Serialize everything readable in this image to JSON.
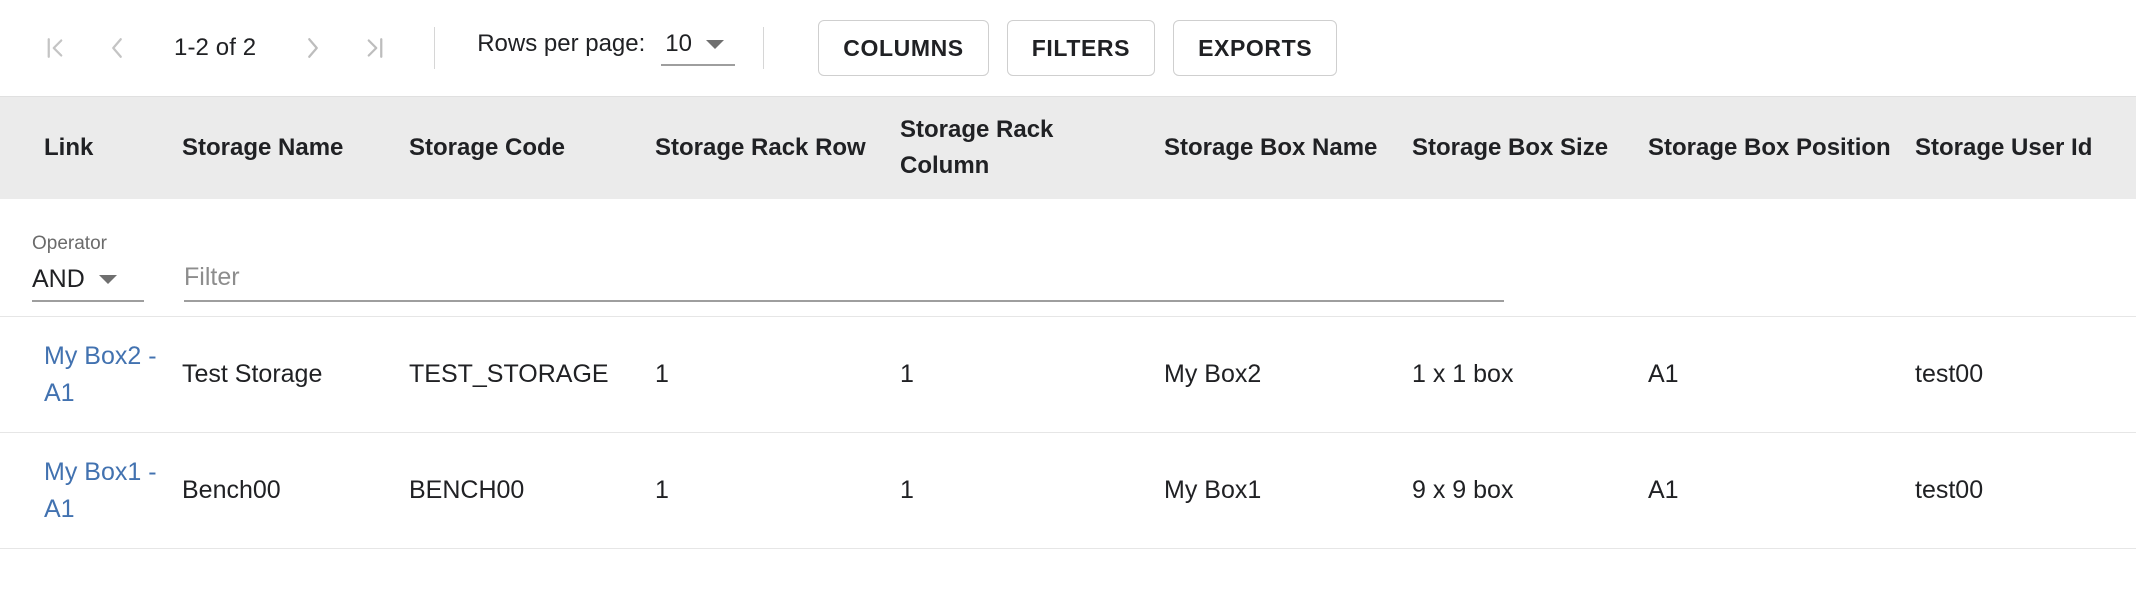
{
  "toolbar": {
    "first_page_icon": "first-page-icon",
    "prev_page_icon": "chevron-left-icon",
    "page_range": "1-2 of 2",
    "next_page_icon": "chevron-right-icon",
    "last_page_icon": "last-page-icon",
    "rows_per_page_label": "Rows per page:",
    "rows_per_page_value": "10",
    "dropdown_icon": "chevron-down-icon",
    "columns_label": "COLUMNS",
    "filters_label": "FILTERS",
    "exports_label": "EXPORTS"
  },
  "filter_bar": {
    "operator_label": "Operator",
    "operator_value": "AND",
    "operator_dropdown_icon": "chevron-down-icon",
    "filter_placeholder": "Filter",
    "filter_value": ""
  },
  "table": {
    "columns": [
      "Link",
      "Storage Name",
      "Storage Code",
      "Storage Rack Row",
      "Storage Rack Column",
      "Storage Box Name",
      "Storage Box Size",
      "Storage Box Position",
      "Storage User Id"
    ],
    "rows": [
      {
        "link": "My Box2 - A1",
        "storage_name": "Test Storage",
        "storage_code": "TEST_STORAGE",
        "storage_rack_row": "1",
        "storage_rack_column": "1",
        "storage_box_name": "My Box2",
        "storage_box_size": "1 x 1 box",
        "storage_box_position": "A1",
        "storage_user_id": "test00"
      },
      {
        "link": "My Box1 - A1",
        "storage_name": "Bench00",
        "storage_code": "BENCH00",
        "storage_rack_row": "1",
        "storage_rack_column": "1",
        "storage_box_name": "My Box1",
        "storage_box_size": "9 x 9 box",
        "storage_box_position": "A1",
        "storage_user_id": "test00"
      }
    ]
  },
  "colors": {
    "link": "#4272b0",
    "header_bg": "#ebebeb",
    "text": "#202124",
    "muted": "#8d8d8d",
    "disabled_icon": "#c4c4c4",
    "active_icon": "#bdbdbd"
  }
}
